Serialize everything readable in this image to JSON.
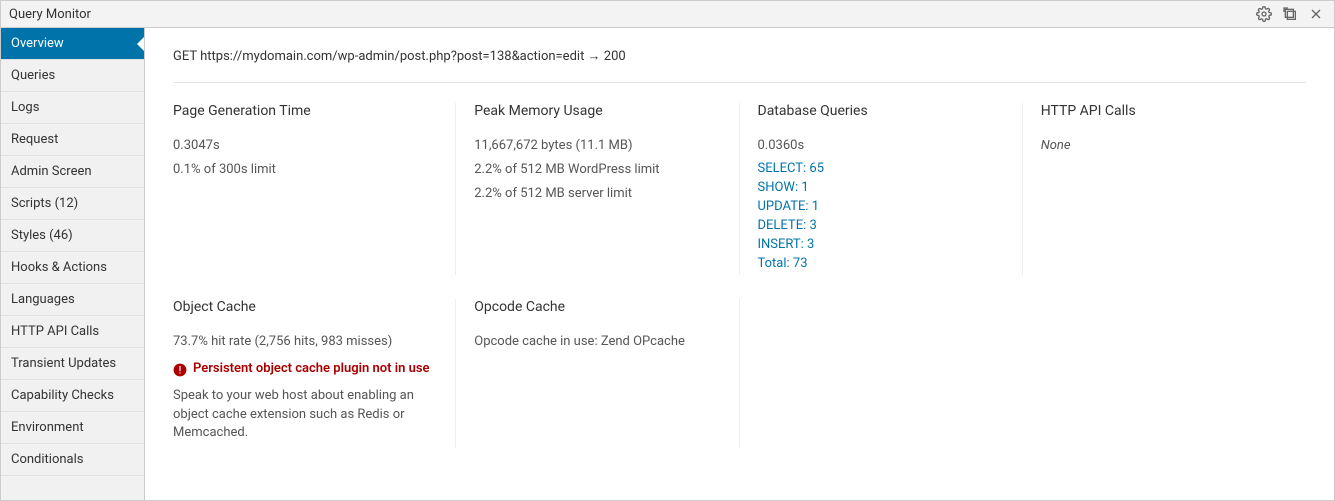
{
  "title": "Query Monitor",
  "sidebar": {
    "items": [
      {
        "label": "Overview",
        "active": true
      },
      {
        "label": "Queries"
      },
      {
        "label": "Logs"
      },
      {
        "label": "Request"
      },
      {
        "label": "Admin Screen"
      },
      {
        "label": "Scripts (12)"
      },
      {
        "label": "Styles (46)"
      },
      {
        "label": "Hooks & Actions"
      },
      {
        "label": "Languages"
      },
      {
        "label": "HTTP API Calls"
      },
      {
        "label": "Transient Updates"
      },
      {
        "label": "Capability Checks"
      },
      {
        "label": "Environment"
      },
      {
        "label": "Conditionals"
      }
    ]
  },
  "request": {
    "line": "GET https://mydomain.com/wp-admin/post.php?post=138&action=edit → 200"
  },
  "sections": {
    "page_time": {
      "heading": "Page Generation Time",
      "value": "0.3047s",
      "limit": "0.1% of 300s limit"
    },
    "memory": {
      "heading": "Peak Memory Usage",
      "value": "11,667,672 bytes (11.1 MB)",
      "wp_limit": "2.2% of 512 MB WordPress limit",
      "server_limit": "2.2% of 512 MB server limit"
    },
    "db": {
      "heading": "Database Queries",
      "time": "0.0360s",
      "select": "SELECT: 65",
      "show": "SHOW: 1",
      "update": "UPDATE: 1",
      "delete": "DELETE: 3",
      "insert": "INSERT: 3",
      "total": "Total: 73"
    },
    "http": {
      "heading": "HTTP API Calls",
      "value": "None"
    },
    "object_cache": {
      "heading": "Object Cache",
      "stats": "73.7% hit rate (2,756 hits, 983 misses)",
      "warning": "Persistent object cache plugin not in use",
      "help": "Speak to your web host about enabling an object cache extension such as Redis or Memcached."
    },
    "opcode": {
      "heading": "Opcode Cache",
      "value": "Opcode cache in use: Zend OPcache"
    }
  }
}
